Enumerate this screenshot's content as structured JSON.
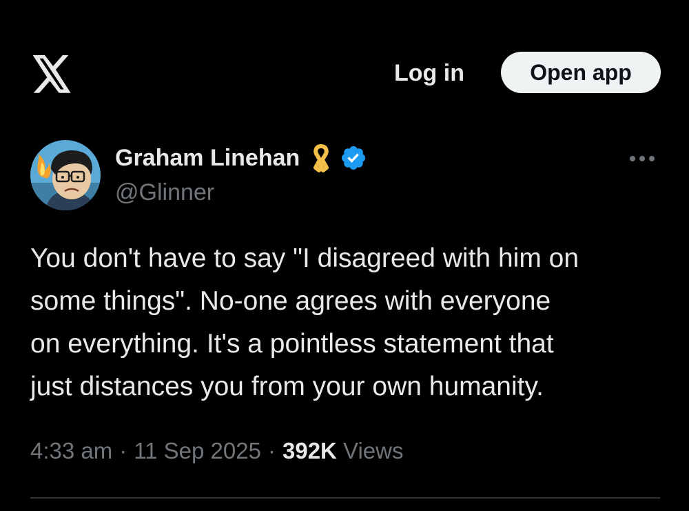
{
  "header": {
    "logo_icon": "x-logo-icon",
    "login_label": "Log in",
    "open_app_label": "Open app"
  },
  "author": {
    "display_name": "Graham Linehan",
    "handle": "@Glinner",
    "badges": [
      "yellow-ribbon-icon",
      "verified-badge-icon"
    ],
    "verified_color": "#1d9bf0",
    "ribbon_color": "#f5c04a"
  },
  "tweet": {
    "lines": [
      "You don't have to say \"I disagreed with him on",
      "some things\". No-one agrees with everyone",
      "on everything. It's a pointless statement that",
      "just distances you from your own humanity."
    ],
    "time": "4:33 am",
    "separator": "·",
    "date": "11 Sep 2025",
    "views_count": "392K",
    "views_label": "Views"
  },
  "menu": {
    "more_icon": "more-options-icon"
  },
  "colors": {
    "background": "#000000",
    "text_primary": "#e7e9ea",
    "text_secondary": "#71767b",
    "button_bg": "#eff3f4"
  }
}
